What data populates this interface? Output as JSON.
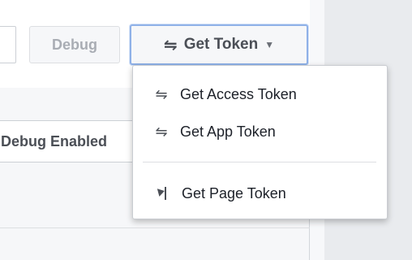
{
  "toolbar": {
    "debug_label": "Debug",
    "get_token_label": "Get Token",
    "get_token_icon": "swap-arrows-icon",
    "get_token_caret": "▼"
  },
  "debug_enabled_label": "Debug Enabled",
  "token_menu": {
    "items": [
      {
        "label": "Get Access Token",
        "icon": "swap-arrows-icon"
      },
      {
        "label": "Get App Token",
        "icon": "swap-arrows-icon"
      },
      {
        "label": "Get Page Token",
        "icon": "flag-icon"
      }
    ]
  },
  "colors": {
    "focus_border": "#8fb1e8",
    "text_dark": "#1d2129",
    "text_muted": "#a9adb4",
    "background": "#e9ebee"
  }
}
